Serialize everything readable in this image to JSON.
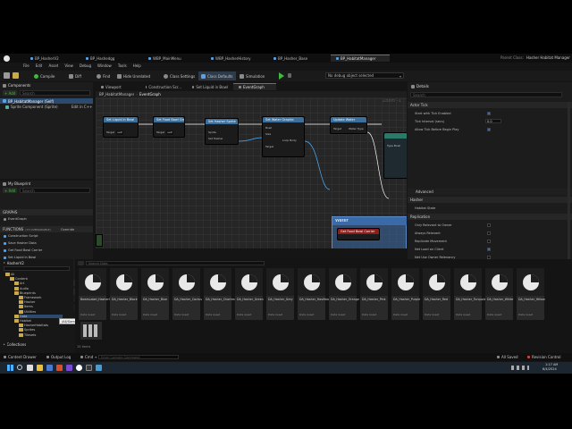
{
  "title_tabs": [
    {
      "label": "BP_HasherV2",
      "active": false
    },
    {
      "label": "BP_Hashedgg",
      "active": false
    },
    {
      "label": "WBP_MainMenu",
      "active": false
    },
    {
      "label": "WBP_HasherHistory",
      "active": false
    },
    {
      "label": "BP_Hasher_Base",
      "active": false
    },
    {
      "label": "BP_HabitatManager",
      "active": true
    }
  ],
  "parent_class": {
    "label": "Parent Class:",
    "value": "Hasher Habitat Manager"
  },
  "menu": [
    "File",
    "Edit",
    "Asset",
    "View",
    "Debug",
    "Window",
    "Tools",
    "Help"
  ],
  "toolbar": {
    "compile": "Compile",
    "diff": "Diff",
    "find": "Find",
    "hide_unrelated": "Hide Unrelated",
    "class_settings": "Class Settings",
    "class_defaults": "Class Defaults",
    "simulation": "Simulation",
    "debug_object": "No debug object selected"
  },
  "components": {
    "title": "Components",
    "add_label": "+ Add",
    "search_placeholder": "Search",
    "self_item": "BP_HabitatManager (Self)",
    "child_item": "Sprite Component (Sprite)",
    "edit_cpp": "Edit in C++"
  },
  "my_blueprint": {
    "title": "My Blueprint",
    "add_label": "+ Add",
    "search_placeholder": "Search",
    "graphs_header": "GRAPHS",
    "graphs_item": "EventGraph",
    "functions_header": "FUNCTIONS",
    "functions_count": "(73 OVERRIDABLE)",
    "override_label": "Override",
    "functions": [
      "Construction Script",
      "Save Hasher Data",
      "Get Food Bowl Carrier",
      "Set Liquid in Bowl",
      "Degrade Ashtray Cleanliness",
      "Degrade Habitat Cleanliness"
    ],
    "interfaces_header": "INTERFACES",
    "macros_header": "MACROS",
    "macros_item": "Get Water Graphic"
  },
  "graph_tabs": [
    {
      "label": "Viewport",
      "active": false
    },
    {
      "label": "Construction Scr...",
      "active": false
    },
    {
      "label": "Set Liquid in Bowl",
      "active": false
    },
    {
      "label": "EventGraph",
      "active": true
    }
  ],
  "breadcrumb": {
    "root": "BP_HabitatManager",
    "sep": "›",
    "current": "EventGraph"
  },
  "zoom": "Zoom -1",
  "graph": {
    "nodes": [
      {
        "title": "Set Liquid In Bowl",
        "pin": "Target",
        "value": "self"
      },
      {
        "title": "Set Food Bowl Graphic",
        "pin": "Target",
        "value": "self"
      },
      {
        "title": "Set Hasher Sprite",
        "pin": "Sprite",
        "value": ""
      },
      {
        "title": "Set Water Graphic",
        "pin": "Target",
        "value": ""
      },
      {
        "title": "Update Water",
        "pin": "Target",
        "value": ""
      }
    ],
    "comment": "Water",
    "comment_sub": "Get Food Bowl Carrier",
    "pin_labels": [
      "Set Hasher",
      "Bowl",
      "Size",
      "Loop Body",
      "Target",
      "Water Type"
    ],
    "node_extra_label": "Type Bowl"
  },
  "details": {
    "title": "Details",
    "search_placeholder": "Search",
    "sections": {
      "actor_tick": "Actor Tick",
      "advanced": "Advanced",
      "hasher": "Hasher",
      "replication": "Replication"
    },
    "actor_tick_props": [
      {
        "label": "Start with Tick Enabled",
        "kind": "check",
        "on": true
      },
      {
        "label": "Tick Interval (secs)",
        "kind": "value",
        "value": "0.0"
      },
      {
        "label": "Allow Tick Before Begin Play",
        "kind": "check",
        "on": true
      }
    ],
    "hasher_props": [
      {
        "label": "Habitat State",
        "kind": "none"
      }
    ],
    "replication_props": [
      {
        "label": "Only Relevant to Owner",
        "kind": "check",
        "on": false
      },
      {
        "label": "Always Relevant",
        "kind": "check",
        "on": false
      },
      {
        "label": "Replicate Movement",
        "kind": "check",
        "on": false
      },
      {
        "label": "Net Load on Client",
        "kind": "check",
        "on": true
      },
      {
        "label": "Net Use Owner Relevancy",
        "kind": "check",
        "on": false
      },
      {
        "label": "Replicates",
        "kind": "check",
        "on": false
      },
      {
        "label": "Net Dormancy",
        "kind": "value",
        "value": "Awake"
      },
      {
        "label": "Net Cull Distance Squared",
        "kind": "value",
        "value": "225000000.0"
      },
      {
        "label": "Net Update Frequency",
        "kind": "value",
        "value": "10.0"
      },
      {
        "label": "Min Net Update Frequency",
        "kind": "value",
        "value": "2.0"
      }
    ]
  },
  "content_browser": {
    "add_label": "+ Add",
    "import_label": "Import",
    "save_all_label": "Save All",
    "path": [
      "All",
      "Content",
      "Data"
    ],
    "settings_label": "Settings",
    "dock_label": "Dock in Layout",
    "favorites": "Favorites",
    "project": "HasherV2",
    "search_placeholder": "Search Data",
    "tree": [
      {
        "label": "All",
        "depth": 0
      },
      {
        "label": "Content",
        "depth": 1
      },
      {
        "label": "Art",
        "depth": 2
      },
      {
        "label": "Audio",
        "depth": 2
      },
      {
        "label": "Blueprints",
        "depth": 2
      },
      {
        "label": "Framework",
        "depth": 3
      },
      {
        "label": "Hasher",
        "depth": 3
      },
      {
        "label": "Items",
        "depth": 3
      },
      {
        "label": "Utilities",
        "depth": 3
      },
      {
        "label": "Data",
        "depth": 2,
        "selected": true
      },
      {
        "label": "Habitat",
        "depth": 2
      },
      {
        "label": "HasherHabitats",
        "depth": 3
      },
      {
        "label": "Sprites",
        "depth": 3
      },
      {
        "label": "Tilesets",
        "depth": 3
      }
    ],
    "tooltip": "/All/Game/Data",
    "collections": "Collections",
    "item_count": "15 items",
    "assets": [
      {
        "name": "BowlsLabel_HasherColors",
        "type": "Data Asset"
      },
      {
        "name": "DA_Hasher_Black",
        "type": "Data Asset"
      },
      {
        "name": "DA_Hasher_Blue",
        "type": "Data Asset"
      },
      {
        "name": "DA_Hasher_Cactus",
        "type": "Data Asset"
      },
      {
        "name": "DA_Hasher_Chartreuse",
        "type": "Data Asset"
      },
      {
        "name": "DA_Hasher_Green",
        "type": "Data Asset"
      },
      {
        "name": "DA_Hasher_Grey",
        "type": "Data Asset"
      },
      {
        "name": "DA_Hasher_HasHdog",
        "type": "Data Asset"
      },
      {
        "name": "DA_Hasher_Orange",
        "type": "Data Asset"
      },
      {
        "name": "DA_Hasher_Pink",
        "type": "Data Asset"
      },
      {
        "name": "DA_Hasher_Purple",
        "type": "Data Asset"
      },
      {
        "name": "DA_Hasher_Red",
        "type": "Data Asset"
      },
      {
        "name": "DA_Hasher_Turquoise",
        "type": "Data Asset"
      },
      {
        "name": "DA_Hasher_White",
        "type": "Data Asset"
      },
      {
        "name": "DA_Hasher_Yellow",
        "type": "Data Asset"
      }
    ]
  },
  "status_bar": {
    "content_drawer": "Content Drawer",
    "output_log": "Output Log",
    "cmd": "Cmd",
    "console_placeholder": "Enter Console Command",
    "all_saved": "All Saved",
    "revision_control": "Revision Control"
  },
  "taskbar": {
    "time": "1:17 AM",
    "date": "8/4/2024"
  },
  "colors": {
    "accent": "#2f7cd6",
    "function_node": "#3b6f9c",
    "event_node": "#8c1d1d",
    "comment": "#3a6aa8",
    "exec": "#ffffff"
  }
}
